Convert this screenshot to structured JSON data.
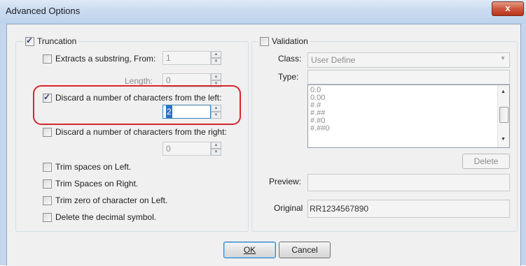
{
  "window": {
    "title": "Advanced Options",
    "close_glyph": "x"
  },
  "truncation": {
    "label": "Truncation",
    "substring": {
      "label": "Extracts a substring, From:",
      "from_value": "1",
      "length_label": "Length:",
      "length_value": "0"
    },
    "discard_left": {
      "label": "Discard a number of characters from the left:",
      "value": "2"
    },
    "discard_right": {
      "label": "Discard a number of characters from the right:",
      "value": "0"
    },
    "trim_left": "Trim spaces on Left.",
    "trim_right": "Trim Spaces on Right.",
    "trim_zero": "Trim zero of character on Left.",
    "delete_decimal": "Delete the decimal symbol."
  },
  "validation": {
    "label": "Validation",
    "class_label": "Class:",
    "class_value": "User Define",
    "type_label": "Type:",
    "type_value": "",
    "formats": [
      "0.0",
      "0.00",
      "#.#",
      "#.##",
      "#.#0",
      "#.##0"
    ],
    "delete_label": "Delete",
    "preview_label": "Preview:",
    "preview_value": "",
    "original_label": "Original",
    "original_value": "RR1234567890"
  },
  "buttons": {
    "ok": "OK",
    "cancel": "Cancel"
  }
}
